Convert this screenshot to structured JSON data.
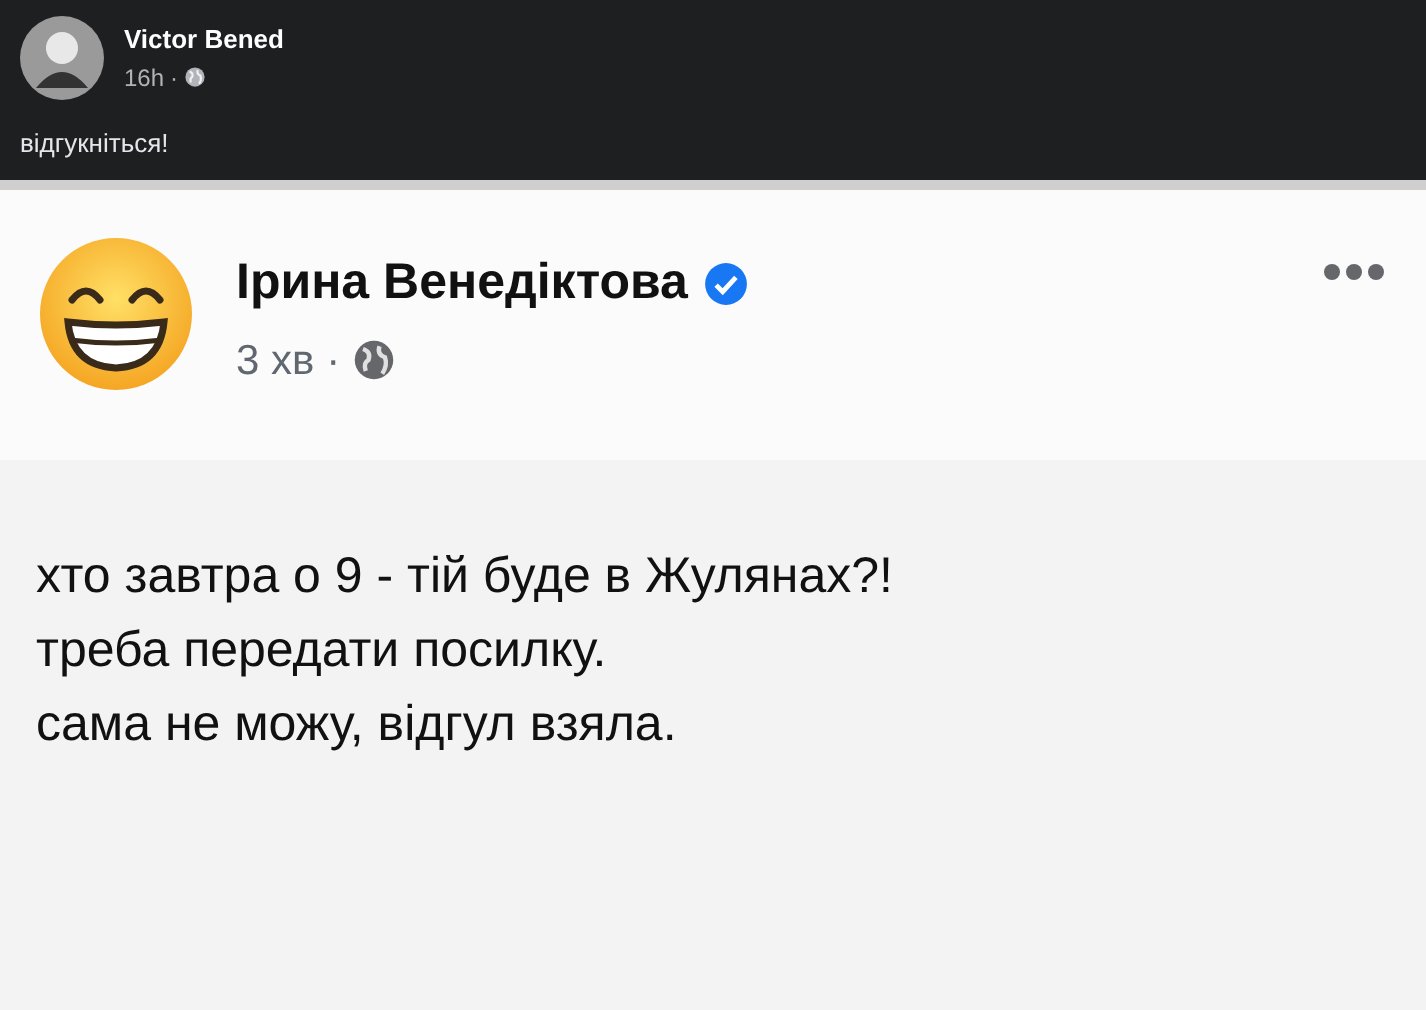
{
  "post": {
    "author": "Victor Bened",
    "time": "16h",
    "separator": "·",
    "text": "відгукніться!"
  },
  "shared_image": {
    "author": "Ірина Венедіктова",
    "verified": true,
    "time": "3 хв",
    "separator": "·",
    "lines": [
      "хто завтра о 9 - тій буде в Жулянах?!",
      "треба передати посилку.",
      "сама не можу, відгул взяла."
    ]
  }
}
